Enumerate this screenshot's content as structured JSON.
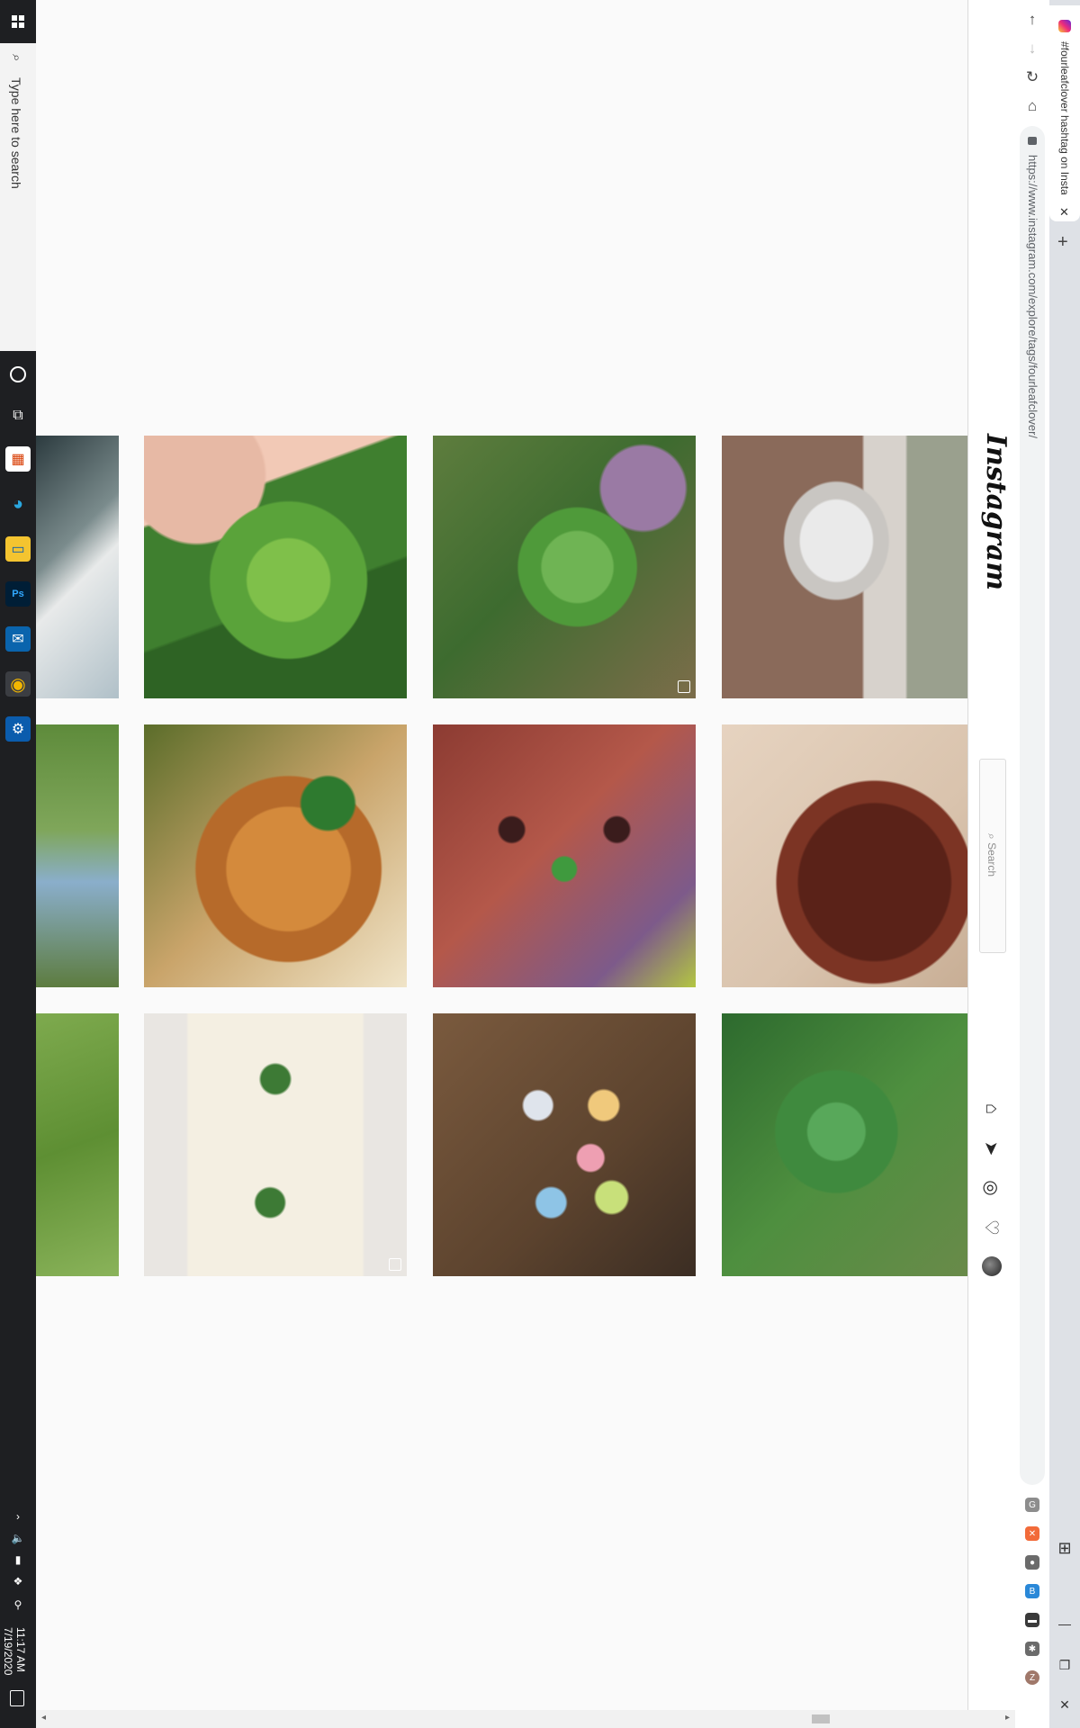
{
  "taskbar": {
    "search_placeholder": "Type here to search",
    "time": "11:17 AM",
    "date": "7/19/2020",
    "apps": [
      "task-view-icon",
      "store-icon",
      "edge-icon",
      "file-explorer-icon",
      "photoshop-icon",
      "outlook-icon",
      "chrome-icon",
      "settings-icon"
    ]
  },
  "browser": {
    "tab_title": "#fourleafclover hashtag on Insta",
    "url": "https://www.instagram.com/explore/tags/fourleafclover/",
    "nav": {
      "back": "↑",
      "forward": "↓",
      "reload": "↻",
      "home": "⌂"
    },
    "new_tab": "+",
    "window": {
      "minimize": "—",
      "restore": "❐",
      "close": "✕"
    },
    "extensions": [
      {
        "name": "g-extension-icon",
        "glyph": "G",
        "color": "#8d8d8d"
      },
      {
        "name": "x-extension-icon",
        "glyph": "✕",
        "color": "#f26b3a"
      },
      {
        "name": "circle-extension-icon",
        "glyph": "●",
        "color": "#6b6b6b"
      },
      {
        "name": "b-extension-icon",
        "glyph": "B",
        "color": "#2a88d8"
      },
      {
        "name": "card-extension-icon",
        "glyph": "▬",
        "color": "#3a3a3a"
      },
      {
        "name": "puzzle-extension-icon",
        "glyph": "✱",
        "color": "#6b6b6b"
      },
      {
        "name": "profile-avatar-icon",
        "glyph": "Z",
        "color": "#a0786a"
      }
    ]
  },
  "instagram": {
    "logo": "Instagram",
    "search_placeholder": "Search",
    "nav_icons": [
      "home-icon",
      "direct-icon",
      "explore-icon",
      "activity-heart-icon",
      "profile-avatar"
    ]
  },
  "grid": {
    "tiles": [
      {
        "name": "post-tile-partial-1",
        "multi": false,
        "bg": "linear-gradient(135deg,#2c3b3f 0%,#7a8b8c 40%,#e8eaea 55%,#b0c0c8 100%)"
      },
      {
        "name": "post-tile-clover-fingers",
        "multi": false,
        "bg": "radial-gradient(circle at 55% 55%,#7fc04a 0 20%,#5aa33a 21% 38%,transparent 39%), radial-gradient(circle at 20% 15%,#e7b9a5 0 22%,transparent 23%), linear-gradient(160deg,#f2c9b6 0 25%,#3f7f2f 26% 60%,#2e6324 61% 100%)"
      },
      {
        "name": "post-tile-clover-grass",
        "multi": true,
        "bg": "radial-gradient(circle at 55% 50%,#6fb454 0 18%,#4f9a3a 19% 30%,transparent 31%), radial-gradient(circle at 80% 20%,#9a7aa4 0 14%,transparent 15%), linear-gradient(135deg,#5e7d3e,#3d6b2f 45%,#7c6d4a 100%)"
      },
      {
        "name": "post-tile-clover-vase",
        "multi": false,
        "bg": "radial-gradient(ellipse at 45% 40%,#eaeaea 0 18%,#c9c6c2 19% 26%,transparent 27%), linear-gradient(90deg,#8a6a5a 0 55%,#d7d2cc 56% 72%,#9aa08e 73% 100%)"
      },
      {
        "name": "post-tile-partial-2",
        "multi": false,
        "bg": "linear-gradient(180deg,#5e8b3b 0%,#7fa65a 40%,#8aaecb 60%,#5d7c3f 100%)"
      },
      {
        "name": "post-tile-clover-ring",
        "multi": false,
        "bg": "radial-gradient(circle at 70% 30%,#2e7a2f 0 10%,transparent 11%), radial-gradient(ellipse at 55% 55%,#d48a3c 0 30%,#b66a2a 31% 45%,transparent 46%), linear-gradient(135deg,#5b6d2a,#c9a46a 50%,#f0e4c8 100%)"
      },
      {
        "name": "post-tile-clover-leather",
        "multi": false,
        "bg": "radial-gradient(circle at 50% 55%,#3f9a3e 0 6%,transparent 7%), radial-gradient(circle at 30% 40%,#3a1c1c 0 5%,transparent 6%), radial-gradient(circle at 70% 40%,#3a1c1c 0 5%,transparent 6%), linear-gradient(135deg,#8c3b32,#b4584a 45%,#7d5a8a 80%,#b3c642 100%)"
      },
      {
        "name": "post-tile-red-hair",
        "multi": false,
        "bg": "radial-gradient(ellipse at 60% 60%,#5a2218 0 35%,#7c3424 36% 45%,transparent 46%), linear-gradient(135deg,#e6d3c0,#d9c3ad 60%,#c7ad94 100%)"
      },
      {
        "name": "post-tile-partial-3",
        "multi": false,
        "bg": "linear-gradient(160deg,#7eaa4e,#5e8f33 50%,#8ab35a 100%)"
      },
      {
        "name": "post-tile-pressed-clover-book",
        "multi": true,
        "bg": "radial-gradient(circle at 50% 25%,#3d7a35 0 6%,transparent 7%), radial-gradient(circle at 48% 72%,#3d7a35 0 6%,transparent 7%), linear-gradient(90deg,#e9e6e2 0 16%,#f4efe2 17% 83%,#e9e6e2 84% 100%)"
      },
      {
        "name": "post-tile-clover-rings",
        "multi": false,
        "bg": "radial-gradient(circle at 40% 35%,#dfe4ec 0 6%,transparent 7%), radial-gradient(circle at 65% 35%,#f0c97c 0 6%,transparent 7%), radial-gradient(circle at 60% 55%,#ee9fb2 0 6%,transparent 7%), radial-gradient(circle at 45% 72%,#8ec4e6 0 6%,transparent 7%), radial-gradient(circle at 68% 70%,#c8e07a 0 6%,transparent 7%), linear-gradient(135deg,#7a5a3e,#5c432e 60%,#3b2d23 100%)"
      },
      {
        "name": "post-tile-clover-patch",
        "multi": false,
        "bg": "radial-gradient(circle at 45% 45%,#58a85a 0 14%,#3f8a3e 15% 30%,transparent 31%), linear-gradient(135deg,#2d6a2e,#4e8f3f 50%,#6a8a4a 100%)"
      }
    ]
  }
}
